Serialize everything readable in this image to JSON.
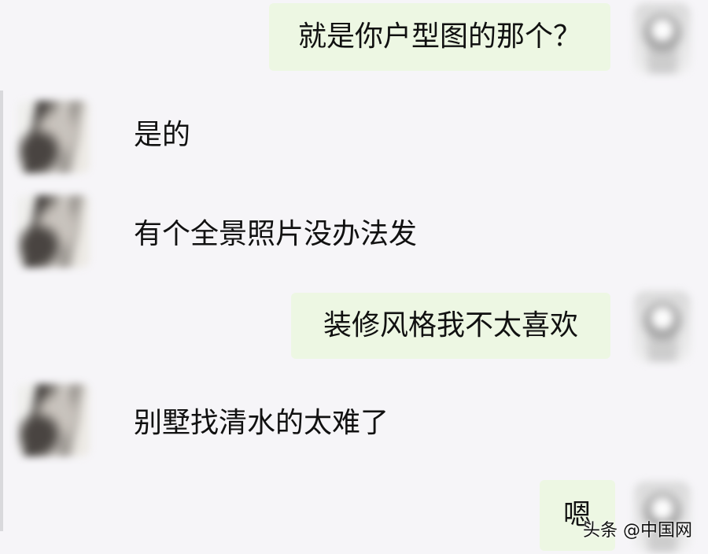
{
  "chat": {
    "messages": [
      {
        "side": "right",
        "text": "就是你户型图的那个？"
      },
      {
        "side": "left",
        "text": "是的"
      },
      {
        "side": "left",
        "text": "有个全景照片没办法发"
      },
      {
        "side": "right",
        "text": "装修风格我不太喜欢"
      },
      {
        "side": "left",
        "text": "别墅找清水的太难了"
      },
      {
        "side": "right",
        "text": "嗯"
      }
    ]
  },
  "watermark": {
    "source_text": "头条 @中国网"
  },
  "colors": {
    "background": "#f6f5f8",
    "outgoing_bubble": "#edf7e3",
    "text": "#111111"
  }
}
